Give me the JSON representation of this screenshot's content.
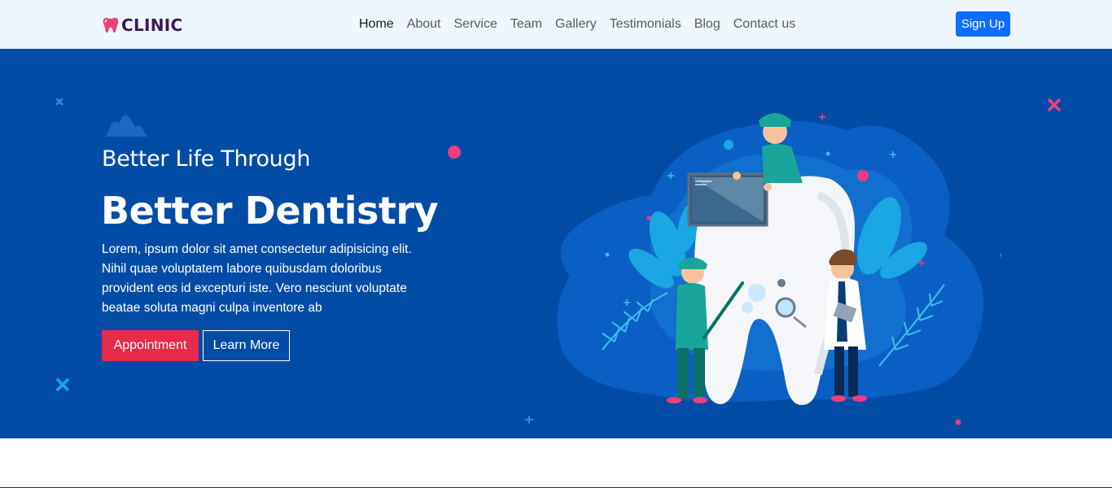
{
  "brand": {
    "name": "CLINIC",
    "icon": "tooth-icon",
    "color": "#3b1860",
    "icon_color": "#f03e7a"
  },
  "nav": {
    "items": [
      {
        "label": "Home",
        "active": true
      },
      {
        "label": "About",
        "active": false
      },
      {
        "label": "Service",
        "active": false
      },
      {
        "label": "Team",
        "active": false
      },
      {
        "label": "Gallery",
        "active": false
      },
      {
        "label": "Testimonials",
        "active": false
      },
      {
        "label": "Blog",
        "active": false
      },
      {
        "label": "Contact us",
        "active": false
      }
    ],
    "signup_label": "Sign Up"
  },
  "hero": {
    "subtitle": "Better Life Through",
    "title": "Better Dentistry",
    "text": "Lorem, ipsum dolor sit amet consectetur adipisicing elit. Nihil quae voluptatem labore quibusdam doloribus provident eos id excepturi iste. Vero nesciunt voluptate beatae soluta magni culpa inventore ab",
    "primary_button": "Appointment",
    "secondary_button": "Learn More",
    "illustration": "dentists-with-giant-tooth-illustration"
  },
  "colors": {
    "navbar_bg": "#edf7fd",
    "hero_bg": "#034ca6",
    "primary": "#0d6efd",
    "accent": "#e62b4a"
  }
}
